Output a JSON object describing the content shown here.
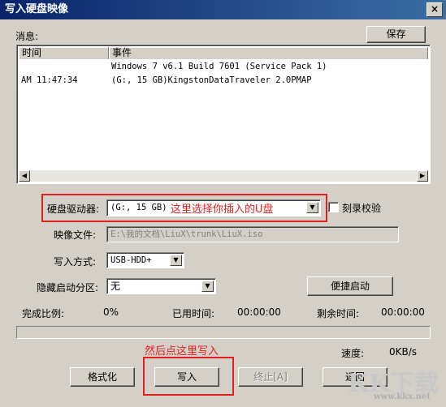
{
  "window": {
    "title": "写入硬盘映像",
    "close_glyph": "×"
  },
  "log": {
    "label": "消息:",
    "save_label": "保存",
    "columns": [
      "时间",
      "事件"
    ],
    "rows": [
      {
        "time": "",
        "event": "Windows 7 v6.1 Build 7601 (Service Pack 1)"
      },
      {
        "time": "AM 11:47:34",
        "event": "(G:, 15 GB)KingstonDataTraveler 2.0PMAP"
      }
    ]
  },
  "drive": {
    "label": "硬盘驱动器:",
    "value": "(G:, 15 GB)",
    "hint": "这里选择你插入的U盘"
  },
  "verify": {
    "label": "刻录校验"
  },
  "image_file": {
    "label": "映像文件:",
    "value": "E:\\我的文档\\LiuX\\trunk\\LiuX.iso"
  },
  "write_mode": {
    "label": "写入方式:",
    "value": "USB-HDD+"
  },
  "hidden_partition": {
    "label": "隐藏启动分区:",
    "value": "无"
  },
  "quick_boot_label": "便捷启动",
  "status": {
    "percent_label": "完成比例:",
    "percent_value": "0%",
    "elapsed_label": "已用时间:",
    "elapsed_value": "00:00:00",
    "remaining_label": "剩余时间:",
    "remaining_value": "00:00:00",
    "speed_label": "速度:",
    "speed_value": "0KB/s",
    "progress": 0
  },
  "annotation_write": "然后点这里写入",
  "buttons": {
    "format": "格式化",
    "write": "写入",
    "stop": "终止[A]",
    "back": "返回"
  },
  "watermark": {
    "brand": "KK下载",
    "url": "www.kkx.net"
  },
  "colors": {
    "accent_red": "#e02020",
    "title_blue": "#0a246a"
  }
}
